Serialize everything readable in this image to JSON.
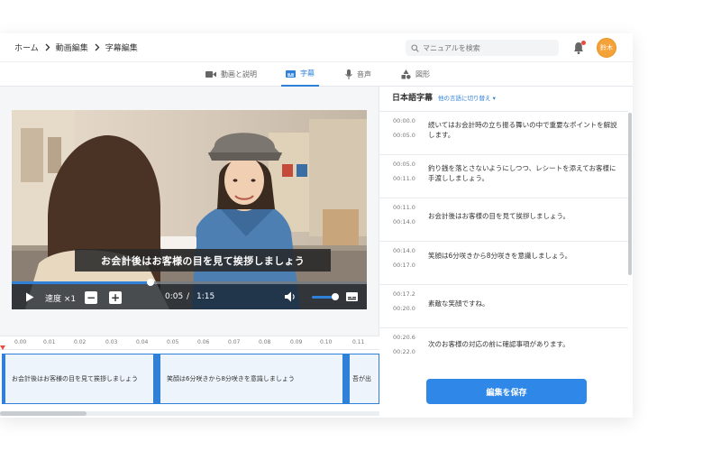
{
  "breadcrumb": {
    "items": [
      "ホーム",
      "動画編集",
      "字幕編集"
    ]
  },
  "search": {
    "placeholder": "マニュアルを検索"
  },
  "avatar": {
    "label": "鈴木"
  },
  "tabs": [
    {
      "label": "動画と説明",
      "icon": "video-camera-icon"
    },
    {
      "label": "字幕",
      "icon": "subtitles-icon",
      "active": true
    },
    {
      "label": "音声",
      "icon": "microphone-icon"
    },
    {
      "label": "図形",
      "icon": "shapes-icon"
    }
  ],
  "video": {
    "caption": "お会計後はお客様の目を見て挨拶しましょう",
    "speed_label": "速度 ×1",
    "current_time": "0:05",
    "time_separator": "/",
    "total_time": "1:15",
    "progress_fraction": 0.39,
    "volume_fraction": 0.8
  },
  "timeline": {
    "ticks": [
      "0.00",
      "0.01",
      "0.02",
      "0.03",
      "0.04",
      "0.05",
      "0.06",
      "0.07",
      "0.08",
      "0.09",
      "0.10",
      "0.11"
    ],
    "clips": [
      {
        "text": "お会計後はお客様の目を見て挨拶しましょう"
      },
      {
        "text": "笑顔は6分咲きから8分咲きを意識しましょう"
      },
      {
        "text": "吾が出"
      }
    ]
  },
  "panel": {
    "title": "日本語字幕",
    "switch_label": "他の言語に切り替え ▾",
    "save_label": "編集を保存",
    "subtitles": [
      {
        "start": "00:00.0",
        "end": "00:05.0",
        "text": "続いてはお会計時の立ち振る舞いの中で重要なポイントを解説します。"
      },
      {
        "start": "00:05.0",
        "end": "00:11.0",
        "text": "釣り銭を落とさないようにしつつ、レシートを添えてお客様に手渡ししましょう。"
      },
      {
        "start": "00:11.0",
        "end": "00:14.0",
        "text": "お会計後はお客様の目を見て挨拶しましょう。"
      },
      {
        "start": "00:14.0",
        "end": "00:17.0",
        "text": "笑顔は6分咲きから8分咲きを意識しましょう。"
      },
      {
        "start": "00:17.2",
        "end": "00:20.0",
        "text": "素敵な笑顔ですね。"
      },
      {
        "start": "00:20.6",
        "end": "00:22.0",
        "text": "次のお客様の対応の前に確認事項があります。"
      }
    ]
  },
  "colors": {
    "accent": "#2f80d8",
    "avatar": "#f4a23a",
    "notification": "#e94b3c"
  }
}
